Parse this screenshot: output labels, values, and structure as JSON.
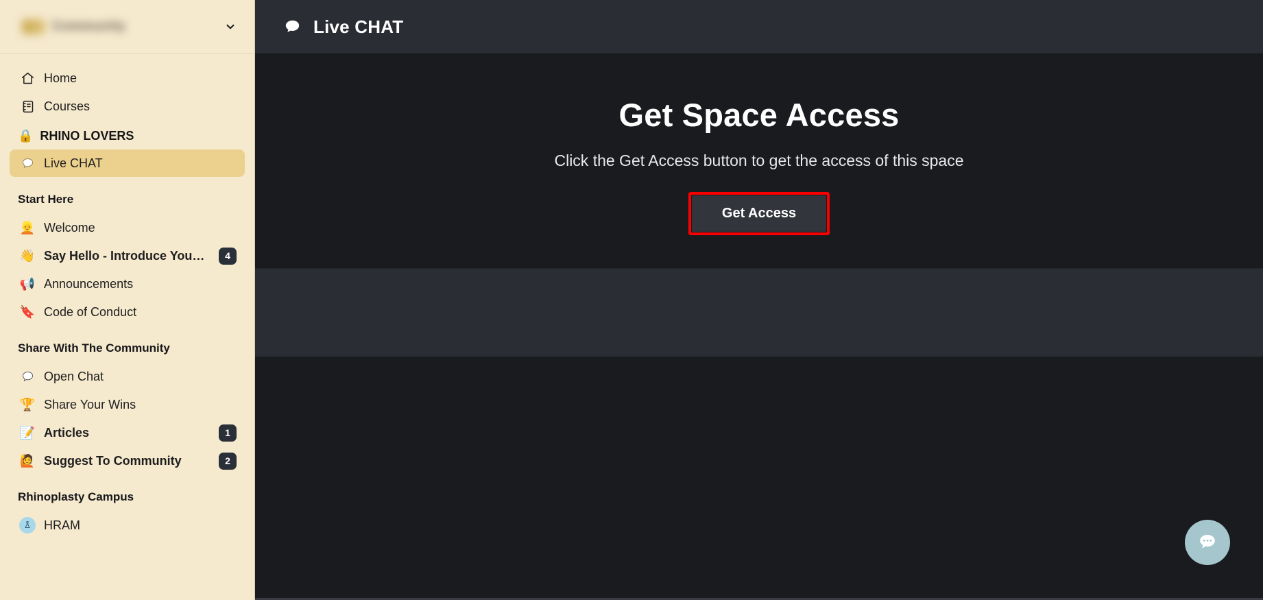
{
  "sidebar": {
    "workspace": {
      "name": "Community",
      "chevron_icon": "chevron-down-icon",
      "redacted": true
    },
    "top_nav": [
      {
        "label": "Home",
        "icon": "home-icon"
      },
      {
        "label": "Courses",
        "icon": "courses-icon"
      }
    ],
    "locked_section": {
      "label": "RHINO LOVERS",
      "icon": "lock-emoji"
    },
    "locked_items": [
      {
        "label": "Live CHAT",
        "icon": "speech-bubble-emoji",
        "active": true,
        "badge": ""
      }
    ],
    "sections": [
      {
        "title": "Start Here",
        "items": [
          {
            "label": "Welcome",
            "icon": "👱",
            "badge": "",
            "bold": false
          },
          {
            "label": "Say Hello - Introduce Yourself ...",
            "icon": "👋",
            "badge": "4",
            "bold": true
          },
          {
            "label": "Announcements",
            "icon": "📢",
            "badge": "",
            "bold": false
          },
          {
            "label": "Code of Conduct",
            "icon": "🔖",
            "badge": "",
            "bold": false
          }
        ]
      },
      {
        "title": "Share With The Community",
        "items": [
          {
            "label": "Open Chat",
            "icon": "💬",
            "badge": "",
            "bold": false
          },
          {
            "label": "Share Your Wins",
            "icon": "🏆",
            "badge": "",
            "bold": false
          },
          {
            "label": "Articles",
            "icon": "📝",
            "badge": "1",
            "bold": true
          },
          {
            "label": "Suggest To Community",
            "icon": "🙋",
            "badge": "2",
            "bold": true
          }
        ]
      },
      {
        "title": "Rhinoplasty Campus",
        "items": [
          {
            "label": "HRAM",
            "icon": "avatar",
            "badge": "",
            "bold": false
          }
        ]
      }
    ]
  },
  "topbar": {
    "icon": "speech-bubble-icon",
    "title": "Live CHAT"
  },
  "hero": {
    "heading": "Get Space Access",
    "subheading": "Click the Get Access button to get the access of this space",
    "button_label": "Get Access",
    "highlight_color": "#f80000"
  },
  "chat_widget": {
    "icon": "chat-dots-icon",
    "color": "#a5c6cd"
  },
  "theme": {
    "sidebar_bg": "#f5e9ce",
    "sidebar_active": "#ecd08d",
    "main_bg": "#191b1f",
    "band_bg": "#2a2e34",
    "topbar_bg": "#2a2d34",
    "badge_bg": "#2b3038"
  }
}
